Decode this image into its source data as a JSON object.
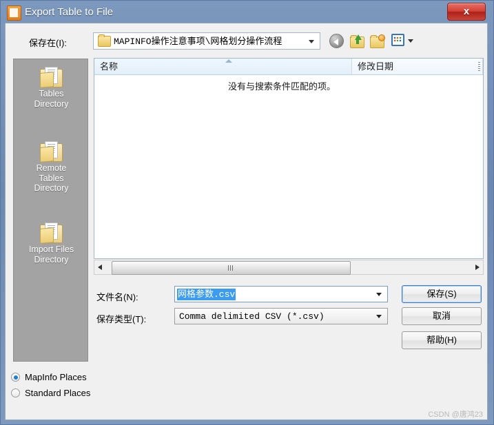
{
  "window": {
    "title": "Export Table to File",
    "icon": "mapinfo-document-icon",
    "close_label": "x"
  },
  "toolbar": {
    "save_in_label": "保存在(I):",
    "path_text": "MAPINFO操作注意事项\\网格划分操作流程",
    "path_folder_icon": "folder-icon",
    "path_dropdown_icon": "chevron-down-icon",
    "buttons": [
      {
        "name": "back-button",
        "icon": "back-arrow-icon"
      },
      {
        "name": "up-one-level-button",
        "icon": "folder-up-icon"
      },
      {
        "name": "new-folder-button",
        "icon": "new-folder-icon"
      },
      {
        "name": "views-button",
        "icon": "views-grid-icon"
      }
    ],
    "views_dropdown_icon": "chevron-down-icon"
  },
  "places": {
    "items": [
      {
        "label": "Tables\nDirectory",
        "line1": "Tables",
        "line2": "Directory",
        "line3": "",
        "icon": "folder-large-icon"
      },
      {
        "label": "Remote Tables Directory",
        "line1": "Remote",
        "line2": "Tables",
        "line3": "Directory",
        "icon": "folder-large-icon"
      },
      {
        "label": "Import Files Directory",
        "line1": "Import Files",
        "line2": "Directory",
        "line3": "",
        "icon": "folder-large-icon"
      }
    ]
  },
  "file_list": {
    "columns": [
      {
        "header": "名称"
      },
      {
        "header": "修改日期"
      }
    ],
    "empty_message": "没有与搜索条件匹配的项。",
    "rows": []
  },
  "scrollbar": {
    "left_arrow_icon": "triangle-left-icon",
    "right_arrow_icon": "triangle-right-icon",
    "thumb_grip_icon": "grip-icon"
  },
  "form": {
    "filename_label": "文件名(N):",
    "filename_value": "网格参数.csv",
    "filetype_label": "保存类型(T):",
    "filetype_value": "Comma delimited CSV (*.csv)",
    "dropdown_icon": "chevron-down-icon"
  },
  "buttons": {
    "save": "保存(S)",
    "cancel": "取消",
    "help": "帮助(H)"
  },
  "places_mode": {
    "options": [
      {
        "label": "MapInfo Places",
        "selected": true
      },
      {
        "label": "Standard Places",
        "selected": false
      }
    ]
  },
  "watermark": "CSDN @唐鸿23",
  "colors": {
    "titlebar": "#6d8ab3",
    "close_button": "#c8453a",
    "selection_blue": "#3d9bf0",
    "places_panel": "#a3a3a3",
    "focus_ring": "#3f7fbf"
  }
}
